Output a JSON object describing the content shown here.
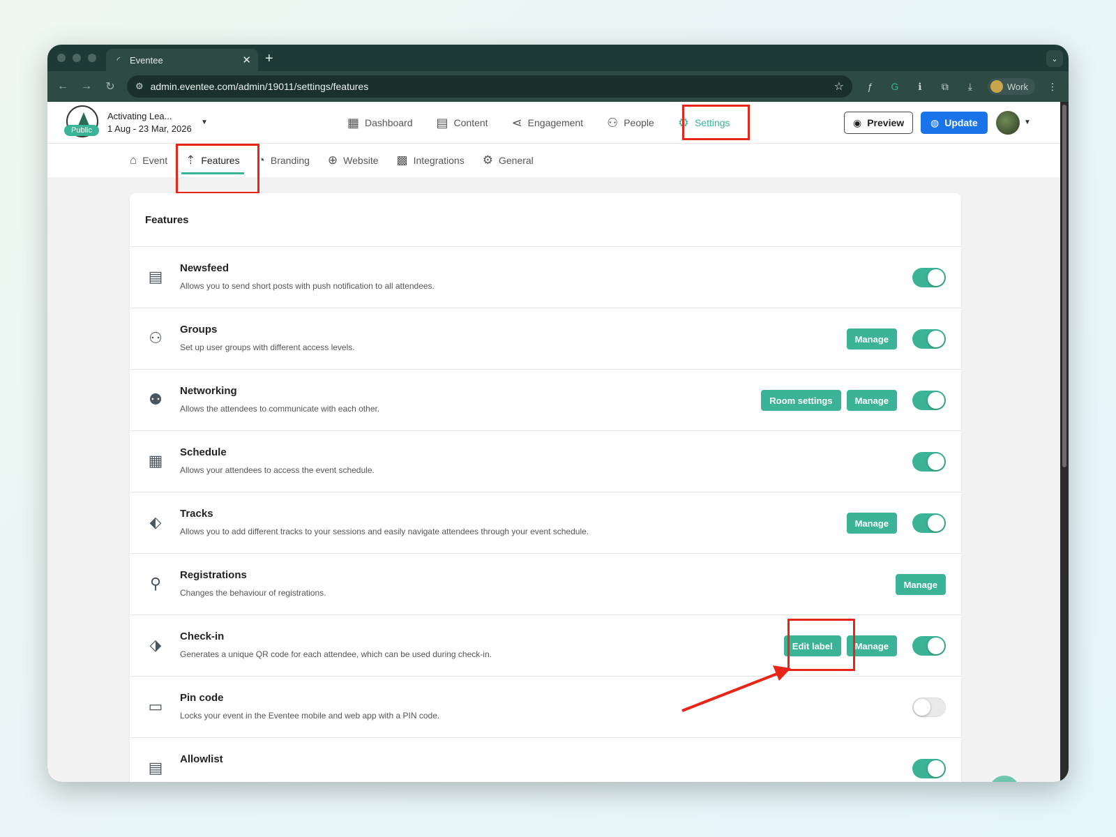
{
  "browser": {
    "tab_title": "Eventee",
    "url": "admin.eventee.com/admin/19011/settings/features",
    "profile_label": "Work"
  },
  "event": {
    "name": "Activating Lea...",
    "dates": "1 Aug - 23 Mar, 2026",
    "badge": "Public"
  },
  "main_nav": {
    "items": [
      {
        "label": "Dashboard",
        "icon": "dashboard-icon"
      },
      {
        "label": "Content",
        "icon": "calendar-icon"
      },
      {
        "label": "Engagement",
        "icon": "share-icon"
      },
      {
        "label": "People",
        "icon": "people-icon"
      },
      {
        "label": "Settings",
        "icon": "gear-icon",
        "active": true
      }
    ],
    "preview_label": "Preview",
    "update_label": "Update"
  },
  "sub_nav": {
    "items": [
      {
        "label": "Event",
        "icon": "home-icon"
      },
      {
        "label": "Features",
        "icon": "rocket-icon",
        "active": true
      },
      {
        "label": "Branding",
        "icon": "palette-icon"
      },
      {
        "label": "Website",
        "icon": "globe-icon"
      },
      {
        "label": "Integrations",
        "icon": "puzzle-icon"
      },
      {
        "label": "General",
        "icon": "gears-icon"
      }
    ]
  },
  "features": {
    "title": "Features",
    "rows": [
      {
        "name": "Newsfeed",
        "desc": "Allows you to send short posts with push notification to all attendees.",
        "icon": "newspaper-icon",
        "toggle": "on"
      },
      {
        "name": "Groups",
        "desc": "Set up user groups with different access levels.",
        "icon": "groups-icon",
        "buttons": [
          "Manage"
        ],
        "toggle": "on"
      },
      {
        "name": "Networking",
        "desc": "Allows the attendees to communicate with each other.",
        "icon": "networking-icon",
        "buttons": [
          "Room settings",
          "Manage"
        ],
        "toggle": "on"
      },
      {
        "name": "Schedule",
        "desc": "Allows your attendees to access the event schedule.",
        "icon": "schedule-icon",
        "toggle": "on"
      },
      {
        "name": "Tracks",
        "desc": "Allows you to add different tracks to your sessions and easily navigate attendees through your event schedule.",
        "icon": "tag-icon",
        "buttons": [
          "Manage"
        ],
        "toggle": "on"
      },
      {
        "name": "Registrations",
        "desc": "Changes the behaviour of registrations.",
        "icon": "user-check-icon",
        "buttons": [
          "Manage"
        ]
      },
      {
        "name": "Check-in",
        "desc": "Generates a unique QR code for each attendee, which can be used during check-in.",
        "icon": "checkin-tag-icon",
        "buttons": [
          "Edit label",
          "Manage"
        ],
        "toggle": "on"
      },
      {
        "name": "Pin code",
        "desc": "Locks your event in the Eventee mobile and web app with a PIN code.",
        "icon": "pin-code-icon",
        "toggle": "off"
      },
      {
        "name": "Allowlist",
        "desc": "",
        "icon": "allowlist-icon",
        "toggle": "on"
      }
    ]
  },
  "colors": {
    "accent": "#3ab397",
    "highlight": "#e9251a",
    "update": "#1a73e8"
  }
}
